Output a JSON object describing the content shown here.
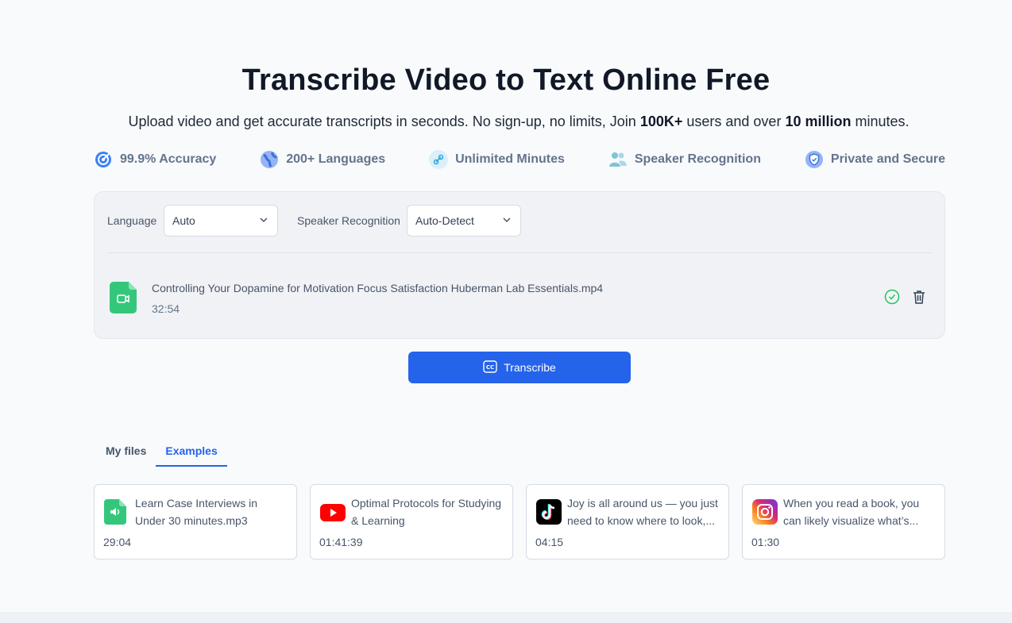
{
  "hero": {
    "title": "Transcribe Video to Text Online Free",
    "subtitle_part1": "Upload video and get accurate transcripts in seconds. No sign-up, no limits, Join ",
    "subtitle_bold1": "100K+",
    "subtitle_part2": " users and over ",
    "subtitle_bold2": "10 million",
    "subtitle_part3": " minutes."
  },
  "features": [
    {
      "label": "99.9% Accuracy",
      "icon": "target-icon"
    },
    {
      "label": "200+ Languages",
      "icon": "globe-icon"
    },
    {
      "label": "Unlimited Minutes",
      "icon": "link-icon"
    },
    {
      "label": "Speaker Recognition",
      "icon": "users-icon"
    },
    {
      "label": "Private and Secure",
      "icon": "shield-icon"
    }
  ],
  "options": {
    "language_label": "Language",
    "language_value": "Auto",
    "speaker_label": "Speaker Recognition",
    "speaker_value": "Auto-Detect"
  },
  "file": {
    "name": "Controlling Your Dopamine for Motivation Focus Satisfaction Huberman Lab Essentials.mp4",
    "duration": "32:54"
  },
  "transcribe_label": "Transcribe",
  "tabs": [
    {
      "label": "My files",
      "active": false
    },
    {
      "label": "Examples",
      "active": true
    }
  ],
  "examples": [
    {
      "title": "Learn Case Interviews in Under 30 minutes.mp3",
      "duration": "29:04",
      "icon": "audio-file-icon"
    },
    {
      "title": "Optimal Protocols for Studying & Learning",
      "duration": "01:41:39",
      "icon": "youtube-icon"
    },
    {
      "title": "Joy is all around us — you just need to know where to look,...",
      "duration": "04:15",
      "icon": "tiktok-icon"
    },
    {
      "title": "When you read a book, you can likely visualize what’s...",
      "duration": "01:30",
      "icon": "instagram-icon"
    }
  ],
  "colors": {
    "accent": "#2563eb",
    "file_green": "#34c77b",
    "check_green": "#22c55e"
  }
}
